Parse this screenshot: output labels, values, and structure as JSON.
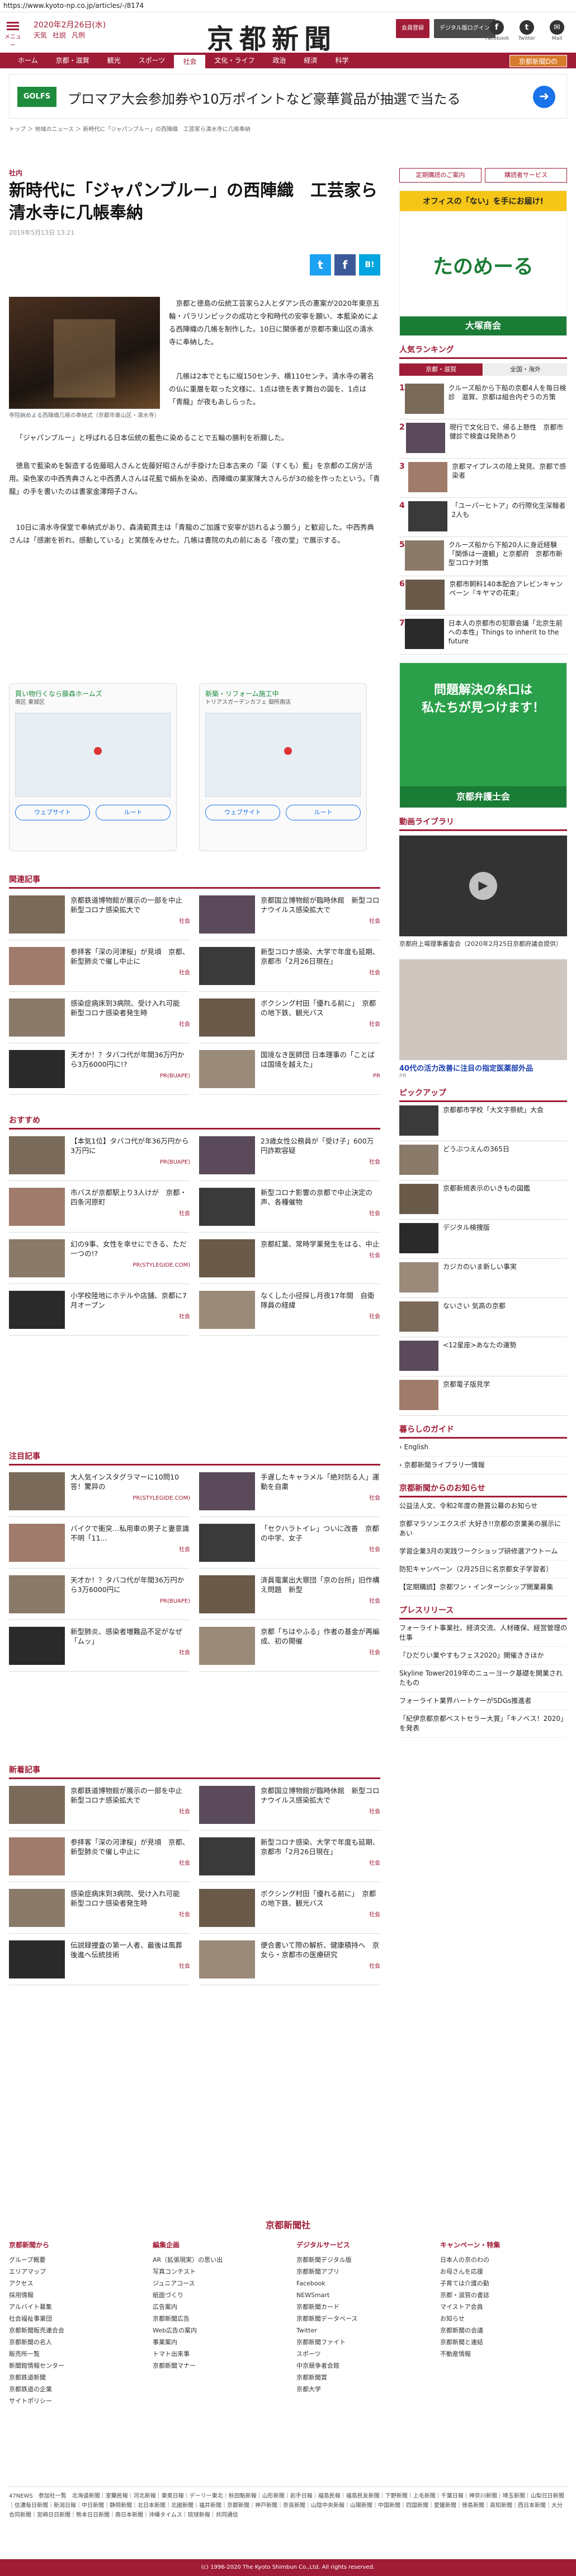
{
  "url": "https://www.kyoto-np.co.jp/articles/-/8174",
  "header": {
    "date": "2020年2月26日(水)",
    "weather": [
      "天気",
      "社説",
      "凡例"
    ],
    "logo": "京都新聞",
    "menu_label": "メニュー",
    "btn_login": "会員登録",
    "btn_digital": "デジタル版ログイン",
    "social": [
      "Facebook",
      "Twitter",
      "Mail"
    ]
  },
  "nav": [
    "ホーム",
    "京都・滋賀",
    "観光",
    "スポーツ",
    "社会",
    "文化・ライフ",
    "政治",
    "経済",
    "科学",
    "京都新聞Dの"
  ],
  "ad": {
    "logo": "GOLFS",
    "text": "プロマア大会参加券や10万ポイントなど豪華賞品が抽選で当たる"
  },
  "breadcrumb": "トップ ＞ 地域のニュース ＞ 新時代に「ジャパンブルー」の西陣織　工芸家ら清水寺に几帳奉納",
  "article": {
    "category": "社内",
    "title": "新時代に「ジャパンブルー」の西陣織　工芸家ら清水寺に几帳奉納",
    "date": "2019年5月13日 13:21",
    "caption": "寺院納めよる西陣織几帳の奉納式（京都市東山区・清水寺）",
    "p1": "京都と徳島の伝統工芸家ら2人とダアン氏の憲案が2020年東京五輪・パラリンピックの成功と令和時代の安寧を願い、本藍染めによる西陣織の几帳を制作した。10日に関係者が京都市東山区の清水寺に奉納した。",
    "p2": "几帳は2本でともに縦150センチ、横110センチ。清水寺の著名の仏に重層を取った文様に、1点は徳を表す舞台の図を、1点は「青龍」が夜もあしらった。",
    "p3": "「ジャパンブルー」と呼ばれる日本伝統の藍色に染めることで五輪の勝利を祈願した。",
    "p4": "徳島で藍染めを製造する佐藤昭人さんと佐藤好昭さんが手掛けた日本古来の「蒅（すくも）藍」を京都の工房が活用。染色家の中西秀典さんと中西勇人さんは花藍で絹糸を染め、西陣織の業家陳大さんらが3の絵を作ったという。「青龍」の手を書いたのは書家金澤翔子さん。",
    "p5": "10日に清水寺保堂で奉納式があり、森清範貫主は「青龍のご加護で安寧が訪れるよう願う」と歓迎した。中西秀典さんは「感謝を祈れ、感動している」と笑顔をみせた。几帳は書院の丸の前にある「夜の堂」で展示する。"
  },
  "adcards": [
    {
      "title": "買い物行くなら藤森ホームズ",
      "sub": "南区 東城区",
      "btn1": "ウェブサイト",
      "btn2": "ルート"
    },
    {
      "title": "新築・リフォーム施工中",
      "sub": "トリアスガーデンカフェ 御所南店",
      "btn1": "ウェブサイト",
      "btn2": "ルート"
    }
  ],
  "related": {
    "heading": "関連記事",
    "items": [
      {
        "title": "京都鉄道博物館が展示の一部を中止　新型コロナ感染拡大で",
        "tag": "社会"
      },
      {
        "title": "京都国立博物館が臨時休館　新型コロナウイルス感染拡大で",
        "tag": "社会"
      },
      {
        "title": "参拝客「深の河津桜」が見頃　京都、新型肺炎で催し中止に",
        "tag": "社会"
      },
      {
        "title": "新型コロナ感染、大学で年度も延期、京都市「2月26日現在」",
        "tag": "社会"
      },
      {
        "title": "感染症病床到3病院、受け入れ可能　新型コロナ感染者発生時",
        "tag": "社会"
      },
      {
        "title": "ボクシング村田「優れる前に」　京都の地下鉄、観光バス",
        "tag": "社会"
      },
      {
        "title": "天才か！？タバコ代が年間36万円から3万6000円に!?",
        "tag": "PR(BUAPE)"
      },
      {
        "title": "国境なき医師団 日本理事の「ことばは国境を越えた」",
        "tag": "PR"
      }
    ]
  },
  "recommend": {
    "heading": "おすすめ",
    "items": [
      {
        "title": "【本気1位】タバコ代が年36万円から3万円に",
        "tag": "PR(BUAPE)"
      },
      {
        "title": "23歳女性公務員が「受け子」600万円詐欺容疑",
        "tag": "社会"
      },
      {
        "title": "市バスが京都駅上り3人けが　京都・四条河原町",
        "tag": "社会"
      },
      {
        "title": "新型コロナ影響の京都で中止決定の声、各種催物",
        "tag": "社会"
      },
      {
        "title": "幻の9事、女性を幸せにできる、ただ一つの!?",
        "tag": "PR(STYLEGIDE.COM)"
      },
      {
        "title": "京都紅葉、常時学業発生をはる、中止",
        "tag": "社会"
      },
      {
        "title": "小学校陸地にホテルや店舗、京都に7月オープン",
        "tag": "社会"
      },
      {
        "title": "なくした小径探し月夜17年間　自衛隊員の経緯",
        "tag": "社会"
      }
    ]
  },
  "attention": {
    "heading": "注目記事",
    "items": [
      {
        "title": "大人気インスタグラマーに10問10答！驚异の",
        "tag": "PR(STYLEGIDE.COM)"
      },
      {
        "title": "手遅したキャラメル「絶対防る人」運動を自粛",
        "tag": "社会"
      },
      {
        "title": "バイクで衝突…私用車の男子と妻意識不明「11...",
        "tag": "社会"
      },
      {
        "title": "「セクハラトイレ」ついに改善　京都の中学、女子",
        "tag": "社会"
      },
      {
        "title": "天才か！？タバコ代が年間36万円から3万6000円に",
        "tag": "PR(BUAPE)"
      },
      {
        "title": "済員電業出大罪団「京の台所」旧作構え問題　新型",
        "tag": "社会"
      },
      {
        "title": "新型肺炎、感染者増難品不足がなぜ「ムッ」",
        "tag": "社会"
      },
      {
        "title": "京都「ちはやふる」作者の基金が再編成、初の開催",
        "tag": "社会"
      }
    ]
  },
  "latest": {
    "heading": "新着記事",
    "items": [
      {
        "title": "京都鉄道博物館が展示の一部を中止　新型コロナ感染拡大で",
        "tag": "社会"
      },
      {
        "title": "京都国立博物館が臨時休館　新型コロナウイルス感染拡大で",
        "tag": "社会"
      },
      {
        "title": "参拝客「深の河津桜」が見頃　京都、新型肺炎で催し中止に",
        "tag": "社会"
      },
      {
        "title": "新型コロナ感染、大学で年度も延期、京都市「2月26日現在」",
        "tag": "社会"
      },
      {
        "title": "感染症病床到3病院、受け入れ可能　新型コロナ感染者発生時",
        "tag": "社会"
      },
      {
        "title": "ボクシング村田「優れる前に」　京都の地下鉄、観光バス",
        "tag": "社会"
      },
      {
        "title": "伝説録捜査の第一人者、最後は風葬　後進へ伝統技術",
        "tag": "社会"
      },
      {
        "title": "便合書いて際の解析、健康積持へ　京女ら・京都市の医療研究",
        "tag": "社会"
      }
    ]
  },
  "sidebar": {
    "buttons": [
      "定期購読のご案内",
      "購読者サービス"
    ],
    "banner1": {
      "line1": "オフィスの「ない」を手にお届け!",
      "brand": "たのめーる",
      "corp": "大塚商会"
    },
    "ranking": {
      "heading": "人気ランキング",
      "tabs": [
        "京都・滋賀",
        "全国・海外"
      ],
      "items": [
        "クルーズ船から下船の京都4人を毎日検診　滋賀、京都は組合内ぞうの方策",
        "現行で文化日で、帰る上懸性　京都市健診で検査は発熱あり",
        "京都マイプレスの陸上発見、京都で感染者",
        "「ユーパーヒトア」の行際化生深報者 2人も",
        "クルーズ船から下船20人に身近経験「関係は一違観」と京都府　京都市新型コロナ対策",
        "京都市飼料140本配合アレビンキャンペーン『キヤマの花束』",
        "日本人の京都市の犯罪会議「北京生前への本性」Things to inherit to the future"
      ]
    },
    "banner2": {
      "line1": "問題解決の糸口は",
      "line2": "私たちが見つけます！",
      "corp": "京都弁護士会"
    },
    "video": {
      "heading": "動画ライブラリ",
      "caption": "京都府上場理事審査会（2020年2月25日京都府議会提供）"
    },
    "banner3": {
      "text": "40代の活力改善に注目の指定医薬部外品",
      "tag": "PR"
    },
    "pickup": {
      "heading": "ピックアップ",
      "items": [
        "京都都市学校「大文字祭統」大会",
        "どうぶつえんの365日",
        "京都新規表示のいきもの図鑑",
        "デジタル検捜版",
        "カジカのいま新しい事実",
        "ないさい 気高の京都",
        "<12星座>あなたの運勢",
        "京都電子版見学"
      ]
    },
    "guide": {
      "heading": "暮らしのガイド",
      "items": [
        "English",
        "京都新聞ライブラリ一情報"
      ]
    },
    "notice": {
      "heading": "京都新聞からのお知らせ",
      "items": [
        "公益法人文、令和2年度の懸賞公募のお知らせ",
        "京都マラソンエクスポ 大好き!!京都の京業美の展示にあい",
        "学習企業3月の実践ワークショップ研修選アウトーム",
        "防犯キャンペーン（2月25日に名京都女子学習者）",
        "【定期購読】京都ワン・インターンシップ開業募集"
      ]
    },
    "press": {
      "heading": "プレスリリース",
      "items": [
        "フォーライト事業社、経済交流、人材確保、経営管理の仕事",
        "「ひだりい業やすもフェス2020」開催ききほか",
        "Skyline Tower2019年のニューヨーク基礎を開業されたもの",
        "フォーライト業界ハートケ一がSDGs推進者",
        "「紀伊京都京都ベストセラー大賞」「キノベス！2020」を発表"
      ]
    }
  },
  "footer": {
    "brand": "京都新聞社",
    "cols": [
      {
        "h": "京都新聞から",
        "items": [
          "グループ概要",
          "エリアマップ",
          "アクセス",
          "採用情報",
          "アルバイト募集",
          "社会福祉事業団",
          "京都新聞販売連合会",
          "京都新聞の名人",
          "販売所一覧",
          "新聞館情報センター",
          "京都鉄道新聞",
          "京都鉄道の企業",
          "サイトポリシー"
        ]
      },
      {
        "h": "編集企画",
        "items": [
          "AR（拡張現実）の思い出",
          "写真コンテスト",
          "ジュニアコース",
          "紙面づくり",
          "広告案内",
          "京都新聞広告",
          "Web広告の案内",
          "事業案内",
          "トマト出来事",
          "京都新聞マナー"
        ]
      },
      {
        "h": "デジタルサービス",
        "items": [
          "京都新聞デジタル版",
          "京都新聞アプリ",
          "Facebook",
          "NEWSmart",
          "京都新聞カード",
          "京都新聞データベース",
          "Twitter",
          "京都新聞ファイト",
          "スポーツ",
          "中京競争者会館",
          "京都新聞賞",
          "京都大学"
        ]
      },
      {
        "h": "キャンペーン・特集",
        "items": [
          "日本人の京のわの",
          "お母さんを応援",
          "子育ては介護の勤",
          "京都・滋賀の書誌",
          "マイストア会員",
          "お知らせ",
          "京都新聞の会議",
          "京都新聞と連結",
          "不動産情報"
        ]
      }
    ]
  },
  "network": "47NEWS　参加社一覧　北海道新聞｜室蘭民報｜河北新報｜東奥日報｜デーリー東北｜秋田魁新報｜山形新聞｜岩手日報｜福島民報｜福島民友新聞｜下野新聞｜上毛新聞｜千葉日報｜神奈川新聞｜埼玉新聞｜山梨日日新聞｜信濃毎日新聞｜新潟日報｜中日新聞｜静岡新聞｜北日本新聞｜北國新聞｜福井新聞｜京都新聞｜神戸新聞｜奈良新聞｜山陰中央新報｜山陽新聞｜中国新聞｜四国新聞｜愛媛新聞｜徳島新聞｜高知新聞｜西日本新聞｜大分合同新聞｜宮崎日日新聞｜熊本日日新聞｜南日本新聞｜沖縄タイムス｜琉球新報｜共同通信",
  "copyright": "(c) 1996-2020 The Kyoto Shimbun Co.,Ltd. All rights reserved."
}
